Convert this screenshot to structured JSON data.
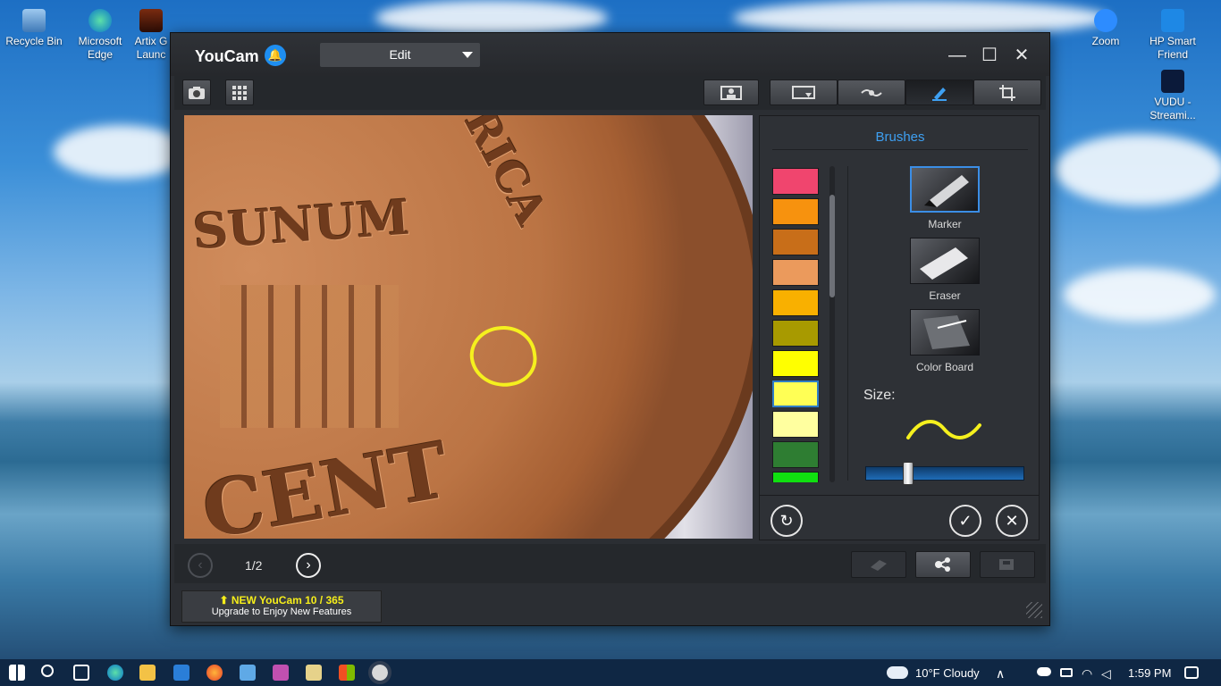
{
  "desktop": {
    "icons": [
      {
        "label": "Recycle Bin"
      },
      {
        "label": "Microsoft Edge"
      },
      {
        "label": "Artix G Launc"
      },
      {
        "label": "Zoom"
      },
      {
        "label": "HP Smart Friend"
      },
      {
        "label": "VUDU - Streami..."
      }
    ]
  },
  "window": {
    "title": "YouCam",
    "mode_select": "Edit",
    "controls": {
      "minimize": "—",
      "maximize": "☐",
      "close": "✕"
    }
  },
  "toolbar": {
    "left_buttons": [
      "camera-icon",
      "grid-icon"
    ],
    "right_buttons": [
      "face-icon",
      "frame-icon",
      "effects-icon",
      "brush-icon",
      "crop-icon"
    ],
    "active": "brush-icon"
  },
  "panel": {
    "title": "Brushes",
    "swatches": [
      "#f0456e",
      "#f7920e",
      "#c86e19",
      "#eb9a5c",
      "#f9b000",
      "#a89a00",
      "#ffff00",
      "#ffff55",
      "#ffff9f",
      "#2e7d32",
      "#10e010"
    ],
    "selected_swatch": 7,
    "brushes": [
      {
        "label": "Marker",
        "selected": true
      },
      {
        "label": "Eraser",
        "selected": false
      },
      {
        "label": "Color Board",
        "selected": false
      }
    ],
    "size_label": "Size:",
    "size_value": 0.25,
    "accent_color": "#3ea0f2"
  },
  "bottom": {
    "pager": "1/2"
  },
  "promo": {
    "line1": "NEW YouCam 10 / 365",
    "line2": "Upgrade to Enjoy New Features"
  },
  "taskbar": {
    "weather": "10°F  Cloudy",
    "time": "1:59 PM"
  }
}
